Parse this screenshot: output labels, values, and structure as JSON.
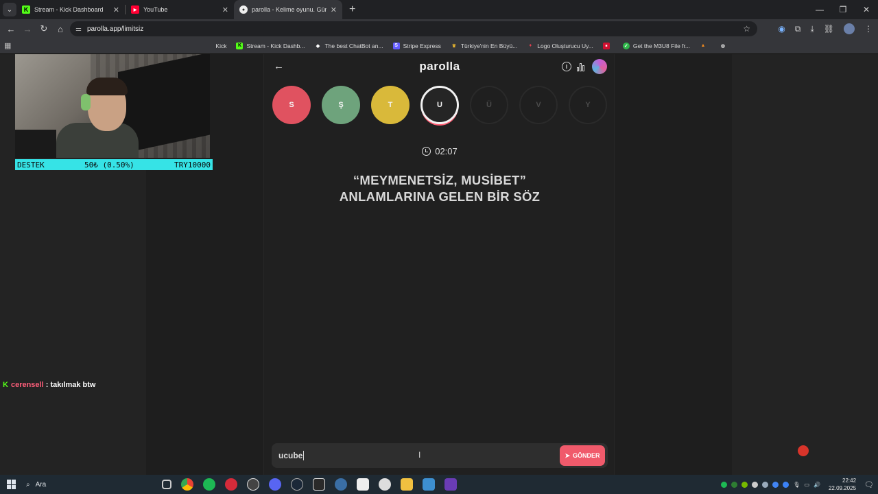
{
  "browser": {
    "tabs": [
      {
        "title": "Stream - Kick Dashboard",
        "icon": "kick-icon"
      },
      {
        "title": "YouTube",
        "icon": "youtube-icon"
      },
      {
        "title": "parolla - Kelime oyunu. Günlük",
        "icon": "parolla-icon"
      }
    ],
    "url": "parolla.app/limitsiz",
    "bookmarks": [
      "Kick",
      "Stream - Kick Dashb...",
      "The best ChatBot an...",
      "Stripe Express",
      "Türkiye'nin En Büyü...",
      "Logo Oluşturucu Uy...",
      "Get the M3U8 File fr..."
    ]
  },
  "overlay": {
    "destek_label": "DESTEK",
    "destek_amount": "50₺ (0.50%)",
    "destek_goal": "TRY10000",
    "chat_user": "cerensell",
    "chat_sep": " : ",
    "chat_message": "takılmak btw"
  },
  "game": {
    "brand": "parolla",
    "letters": [
      {
        "char": "S",
        "state": "wrong",
        "color": "#e05260"
      },
      {
        "char": "Ş",
        "state": "correct",
        "color": "#6ea37c"
      },
      {
        "char": "T",
        "state": "skipped",
        "color": "#d9b93a"
      },
      {
        "char": "U",
        "state": "current",
        "color": "#252525"
      },
      {
        "char": "Ü",
        "state": "pending",
        "color": "#1f1f1f"
      },
      {
        "char": "V",
        "state": "pending",
        "color": "#1f1f1f"
      },
      {
        "char": "Y",
        "state": "pending",
        "color": "#1f1f1f"
      }
    ],
    "timer": "02:07",
    "question_line1": "“MEYMENETSİZ, MUSİBET”",
    "question_line2": "ANLAMLARINA GELEN BİR SÖZ",
    "answer_value": "ucube",
    "send_label": "GÖNDER"
  },
  "taskbar": {
    "search_placeholder": "Ara",
    "time": "22:42",
    "date": "22.09.2025"
  }
}
